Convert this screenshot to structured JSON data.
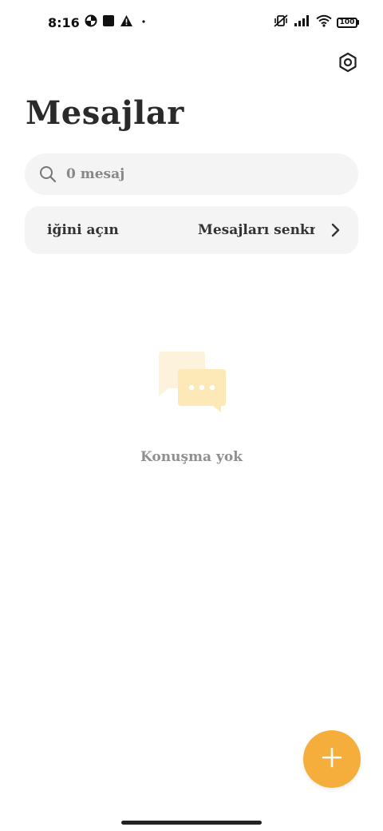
{
  "status_bar": {
    "time": "8:16",
    "battery": "100",
    "icons": [
      "data-saver-icon",
      "square-notification-icon",
      "warning-icon",
      "dot-icon",
      "vibrate-off-icon",
      "signal-icon",
      "wifi-icon",
      "battery-icon"
    ]
  },
  "header": {
    "title": "Mesajlar",
    "settings_icon": "settings-icon"
  },
  "search": {
    "placeholder": "0 mesaj",
    "value": ""
  },
  "sync_banner": {
    "left_text": "iğini açın",
    "right_text": "Mesajları senkro",
    "chevron_icon": "chevron-right-icon"
  },
  "empty_state": {
    "icon": "chat-bubbles-icon",
    "text": "Konuşma yok"
  },
  "fab": {
    "icon": "plus-icon"
  },
  "colors": {
    "accent": "#f5ad3c",
    "surface": "#f4f4f4",
    "empty_icon_back": "#fdf3dc",
    "empty_icon_front": "#fde8b8"
  }
}
